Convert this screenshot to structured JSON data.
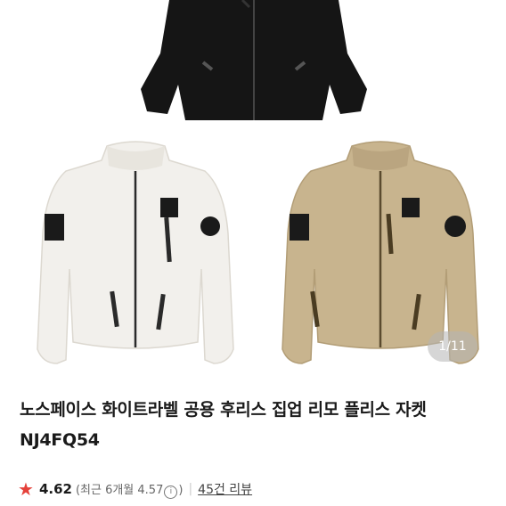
{
  "gallery": {
    "counter": "1/11",
    "colors": {
      "black": "#151515",
      "white": "#f2f0ec",
      "beige": "#c8b48e"
    }
  },
  "product": {
    "title_line1": "노스페이스 화이트라벨 공용 후리스 집업 리모 플리스 자켓",
    "title_line2": "NJ4FQ54"
  },
  "rating": {
    "score": "4.62",
    "recent_prefix": "(최근 6개월 4.57",
    "info_symbol": "i",
    "recent_suffix": ")",
    "separator": "|",
    "reviews": "45건 리뷰"
  }
}
